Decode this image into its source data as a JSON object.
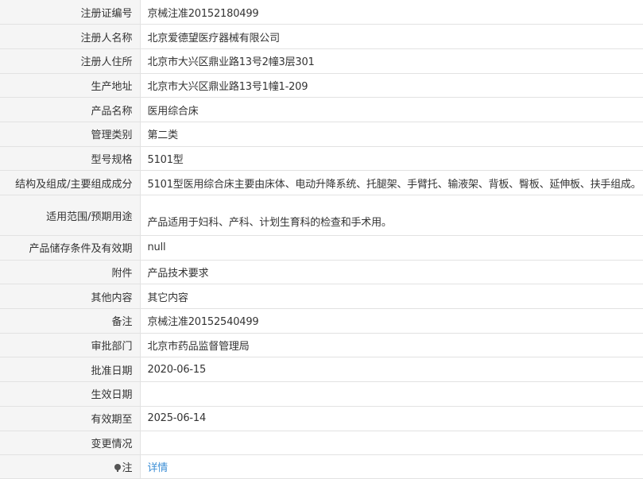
{
  "rows": [
    {
      "label": "注册证编号",
      "value": "京械注准20152180499"
    },
    {
      "label": "注册人名称",
      "value": "北京爱德望医疗器械有限公司"
    },
    {
      "label": "注册人住所",
      "value": "北京市大兴区鼎业路13号2幢3层301"
    },
    {
      "label": "生产地址",
      "value": "北京市大兴区鼎业路13号1幢1-209"
    },
    {
      "label": "产品名称",
      "value": "医用综合床"
    },
    {
      "label": "管理类别",
      "value": "第二类"
    },
    {
      "label": "型号规格",
      "value": "5101型"
    },
    {
      "label": "结构及组成/主要组成成分",
      "value": "5101型医用综合床主要由床体、电动升降系统、托腿架、手臂托、输液架、背板、臀板、延伸板、扶手组成。"
    },
    {
      "label": "适用范围/预期用途",
      "value": "产品适用于妇科、产科、计划生育科的检查和手术用。"
    },
    {
      "label": "产品储存条件及有效期",
      "value": "null"
    },
    {
      "label": "附件",
      "value": "产品技术要求"
    },
    {
      "label": "其他内容",
      "value": "其它内容"
    },
    {
      "label": "备注",
      "value": "京械注准20152540499"
    },
    {
      "label": "审批部门",
      "value": "北京市药品监督管理局"
    },
    {
      "label": "批准日期",
      "value": "2020-06-15"
    },
    {
      "label": "生效日期",
      "value": ""
    },
    {
      "label": "有效期至",
      "value": "2025-06-14"
    },
    {
      "label": "变更情况",
      "value": ""
    }
  ],
  "note": {
    "label": "注",
    "link_text": "详情",
    "icon": "lightbulb-icon"
  }
}
